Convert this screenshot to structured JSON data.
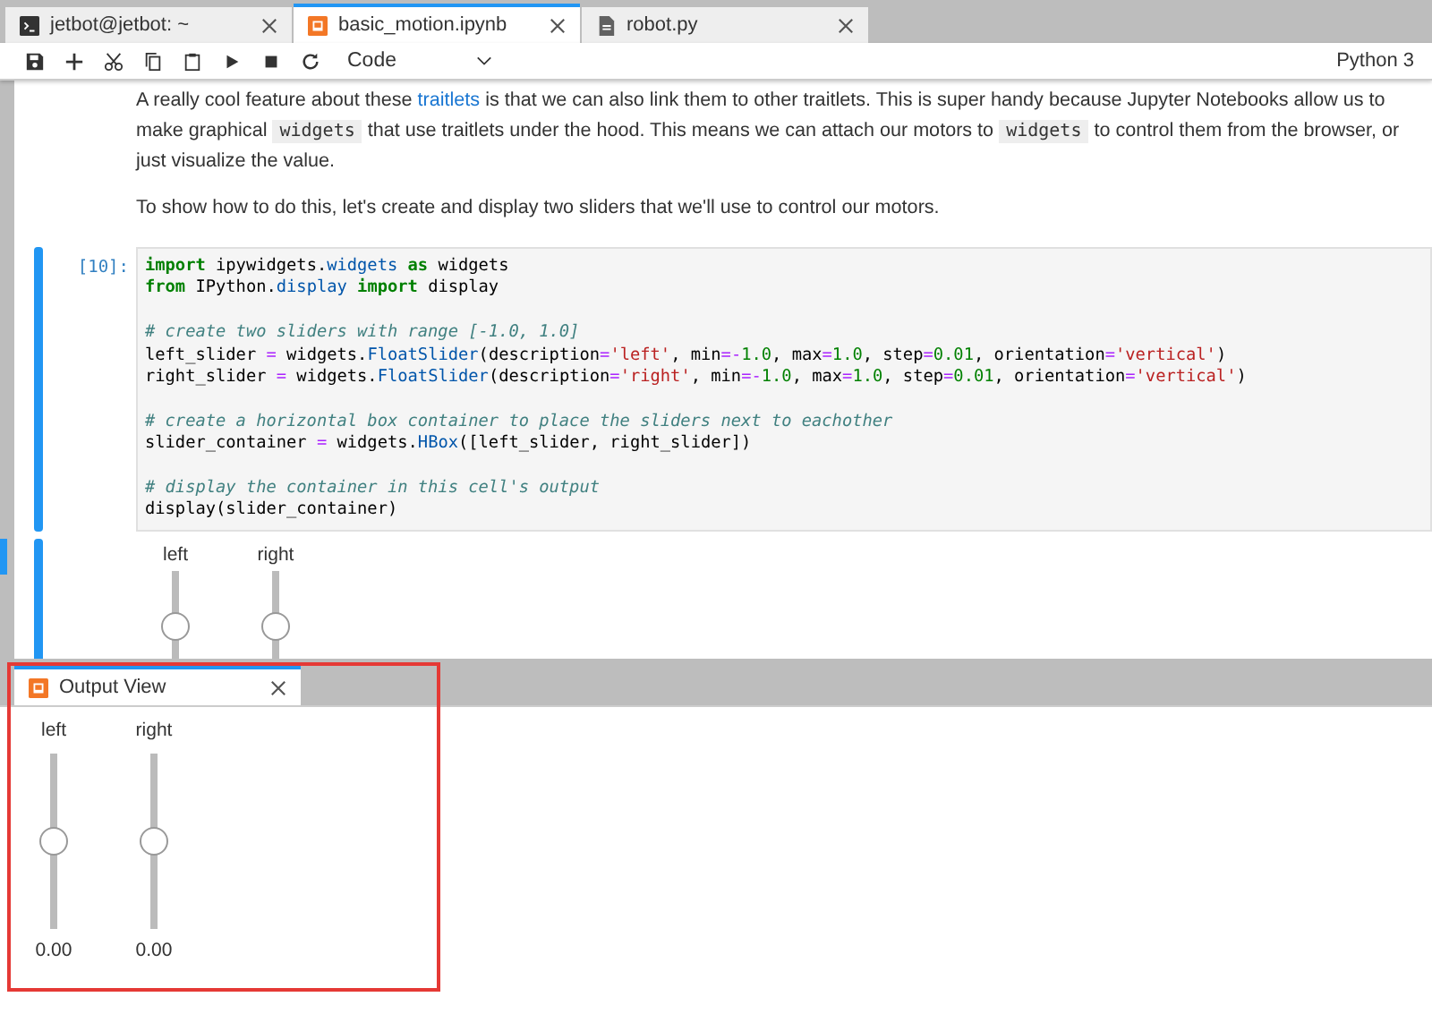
{
  "tabs": [
    {
      "label": "jetbot@jetbot: ~",
      "kind": "terminal",
      "selected": false
    },
    {
      "label": "basic_motion.ipynb",
      "kind": "notebook",
      "selected": true
    },
    {
      "label": "robot.py",
      "kind": "file",
      "selected": false
    }
  ],
  "toolbar": {
    "cell_type": "Code",
    "kernel": "Python 3"
  },
  "markdown": [
    [
      {
        "kind": "plain",
        "t": "A really cool feature about these "
      },
      {
        "kind": "link",
        "t": "traitlets"
      },
      {
        "kind": "plain",
        "t": " is that we can also link them to other traitlets. This is super handy because Jupyter Notebooks allow us to make graphical "
      },
      {
        "kind": "code",
        "t": "widgets"
      },
      {
        "kind": "plain",
        "t": " that use traitlets under the hood. This means we can attach our motors to "
      },
      {
        "kind": "code",
        "t": "widgets"
      },
      {
        "kind": "plain",
        "t": " to control them from the browser, or just visualize the value."
      }
    ],
    [
      {
        "kind": "plain",
        "t": "To show how to do this, let's create and display two sliders that we'll use to control our motors."
      }
    ]
  ],
  "cell": {
    "prompt": "[10]:",
    "lines": [
      {
        "gap_before": false,
        "segs": [
          {
            "kind": "keyword",
            "t": "import"
          },
          {
            "kind": "plain",
            "t": " ipywidgets."
          },
          {
            "kind": "name",
            "t": "widgets"
          },
          {
            "kind": "keyword",
            "t": " as"
          },
          {
            "kind": "plain",
            "t": " widgets"
          }
        ]
      },
      {
        "gap_before": false,
        "segs": [
          {
            "kind": "keyword",
            "t": "from"
          },
          {
            "kind": "plain",
            "t": " IPython."
          },
          {
            "kind": "name",
            "t": "display"
          },
          {
            "kind": "keyword",
            "t": " import"
          },
          {
            "kind": "plain",
            "t": " display"
          }
        ]
      },
      {
        "gap_before": true,
        "segs": [
          {
            "kind": "comment",
            "t": "# create two sliders with range [-1.0, 1.0]"
          }
        ]
      },
      {
        "gap_before": false,
        "segs": [
          {
            "kind": "plain",
            "t": "left_slider "
          },
          {
            "kind": "operator",
            "t": "="
          },
          {
            "kind": "plain",
            "t": " widgets."
          },
          {
            "kind": "name",
            "t": "FloatSlider"
          },
          {
            "kind": "plain",
            "t": "(description"
          },
          {
            "kind": "operator",
            "t": "="
          },
          {
            "kind": "string",
            "t": "'left'"
          },
          {
            "kind": "plain",
            "t": ", min"
          },
          {
            "kind": "operator",
            "t": "=-"
          },
          {
            "kind": "number",
            "t": "1.0"
          },
          {
            "kind": "plain",
            "t": ", max"
          },
          {
            "kind": "operator",
            "t": "="
          },
          {
            "kind": "number",
            "t": "1.0"
          },
          {
            "kind": "plain",
            "t": ", step"
          },
          {
            "kind": "operator",
            "t": "="
          },
          {
            "kind": "number",
            "t": "0.01"
          },
          {
            "kind": "plain",
            "t": ", orientation"
          },
          {
            "kind": "operator",
            "t": "="
          },
          {
            "kind": "string",
            "t": "'vertical'"
          },
          {
            "kind": "plain",
            "t": ")"
          }
        ]
      },
      {
        "gap_before": false,
        "segs": [
          {
            "kind": "plain",
            "t": "right_slider "
          },
          {
            "kind": "operator",
            "t": "="
          },
          {
            "kind": "plain",
            "t": " widgets."
          },
          {
            "kind": "name",
            "t": "FloatSlider"
          },
          {
            "kind": "plain",
            "t": "(description"
          },
          {
            "kind": "operator",
            "t": "="
          },
          {
            "kind": "string",
            "t": "'right'"
          },
          {
            "kind": "plain",
            "t": ", min"
          },
          {
            "kind": "operator",
            "t": "=-"
          },
          {
            "kind": "number",
            "t": "1.0"
          },
          {
            "kind": "plain",
            "t": ", max"
          },
          {
            "kind": "operator",
            "t": "="
          },
          {
            "kind": "number",
            "t": "1.0"
          },
          {
            "kind": "plain",
            "t": ", step"
          },
          {
            "kind": "operator",
            "t": "="
          },
          {
            "kind": "number",
            "t": "0.01"
          },
          {
            "kind": "plain",
            "t": ", orientation"
          },
          {
            "kind": "operator",
            "t": "="
          },
          {
            "kind": "string",
            "t": "'vertical'"
          },
          {
            "kind": "plain",
            "t": ")"
          }
        ]
      },
      {
        "gap_before": true,
        "segs": [
          {
            "kind": "comment",
            "t": "# create a horizontal box container to place the sliders next to eachother"
          }
        ]
      },
      {
        "gap_before": false,
        "segs": [
          {
            "kind": "plain",
            "t": "slider_container "
          },
          {
            "kind": "operator",
            "t": "="
          },
          {
            "kind": "plain",
            "t": " widgets."
          },
          {
            "kind": "name",
            "t": "HBox"
          },
          {
            "kind": "plain",
            "t": "([left_slider, right_slider])"
          }
        ]
      },
      {
        "gap_before": true,
        "segs": [
          {
            "kind": "comment",
            "t": "# display the container in this cell's output"
          }
        ]
      },
      {
        "gap_before": false,
        "segs": [
          {
            "kind": "plain",
            "t": "display(slider_container)"
          }
        ]
      }
    ]
  },
  "cell_output_sliders": [
    {
      "label": "left",
      "level": 0.5
    },
    {
      "label": "right",
      "level": 0.5
    }
  ],
  "output_view": {
    "title": "Output View",
    "sliders": [
      {
        "label": "left",
        "level": 0.5,
        "reading": "0.00"
      },
      {
        "label": "right",
        "level": 0.5,
        "reading": "0.00"
      }
    ]
  }
}
